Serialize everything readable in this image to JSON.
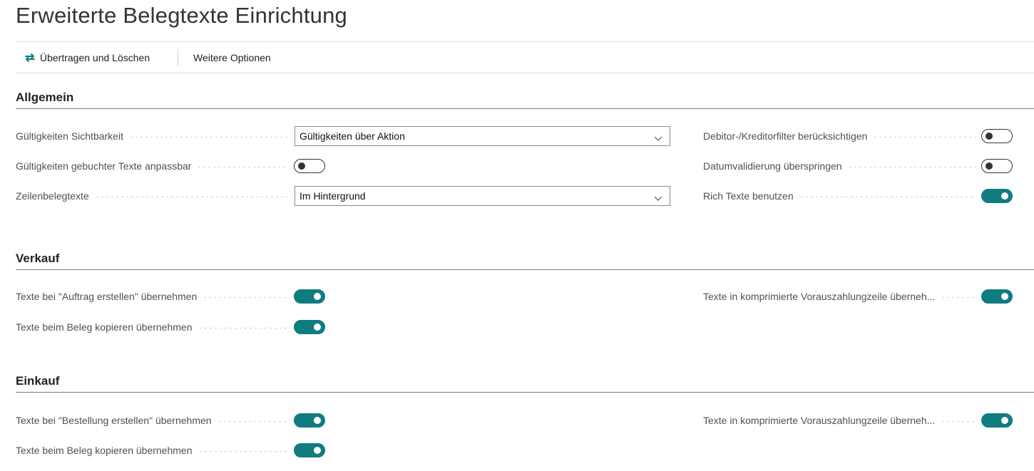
{
  "page": {
    "title": "Erweiterte Belegtexte Einrichtung"
  },
  "actions": {
    "transfer_label": "Übertragen und Löschen",
    "more_label": "Weitere Optionen",
    "accent_color": "#107c80"
  },
  "sections": {
    "allgemein": {
      "title": "Allgemein",
      "visibility_label": "Gültigkeiten Sichtbarkeit",
      "visibility_value": "Gültigkeiten über Aktion",
      "posted_editable_label": "Gültigkeiten gebuchter Texte anpassbar",
      "posted_editable_on": false,
      "line_texts_label": "Zeilenbelegtexte",
      "line_texts_value": "Im Hintergrund",
      "filter_label": "Debitor-/Kreditorfilter berücksichtigen",
      "filter_on": false,
      "date_skip_label": "Datumvalidierung überspringen",
      "date_skip_on": false,
      "rich_label": "Rich Texte benutzen",
      "rich_on": true
    },
    "verkauf": {
      "title": "Verkauf",
      "order_label": "Texte bei \"Auftrag erstellen\" übernehmen",
      "order_on": true,
      "copy_label": "Texte beim Beleg kopieren übernehmen",
      "copy_on": true,
      "prepay_label": "Texte in komprimierte Vorauszahlungzeile überneh...",
      "prepay_on": true
    },
    "einkauf": {
      "title": "Einkauf",
      "order_label": "Texte bei \"Bestellung erstellen\" übernehmen",
      "order_on": true,
      "copy_label": "Texte beim Beleg kopieren übernehmen",
      "copy_on": true,
      "prepay_label": "Texte in komprimierte Vorauszahlungzeile überneh...",
      "prepay_on": true
    }
  }
}
